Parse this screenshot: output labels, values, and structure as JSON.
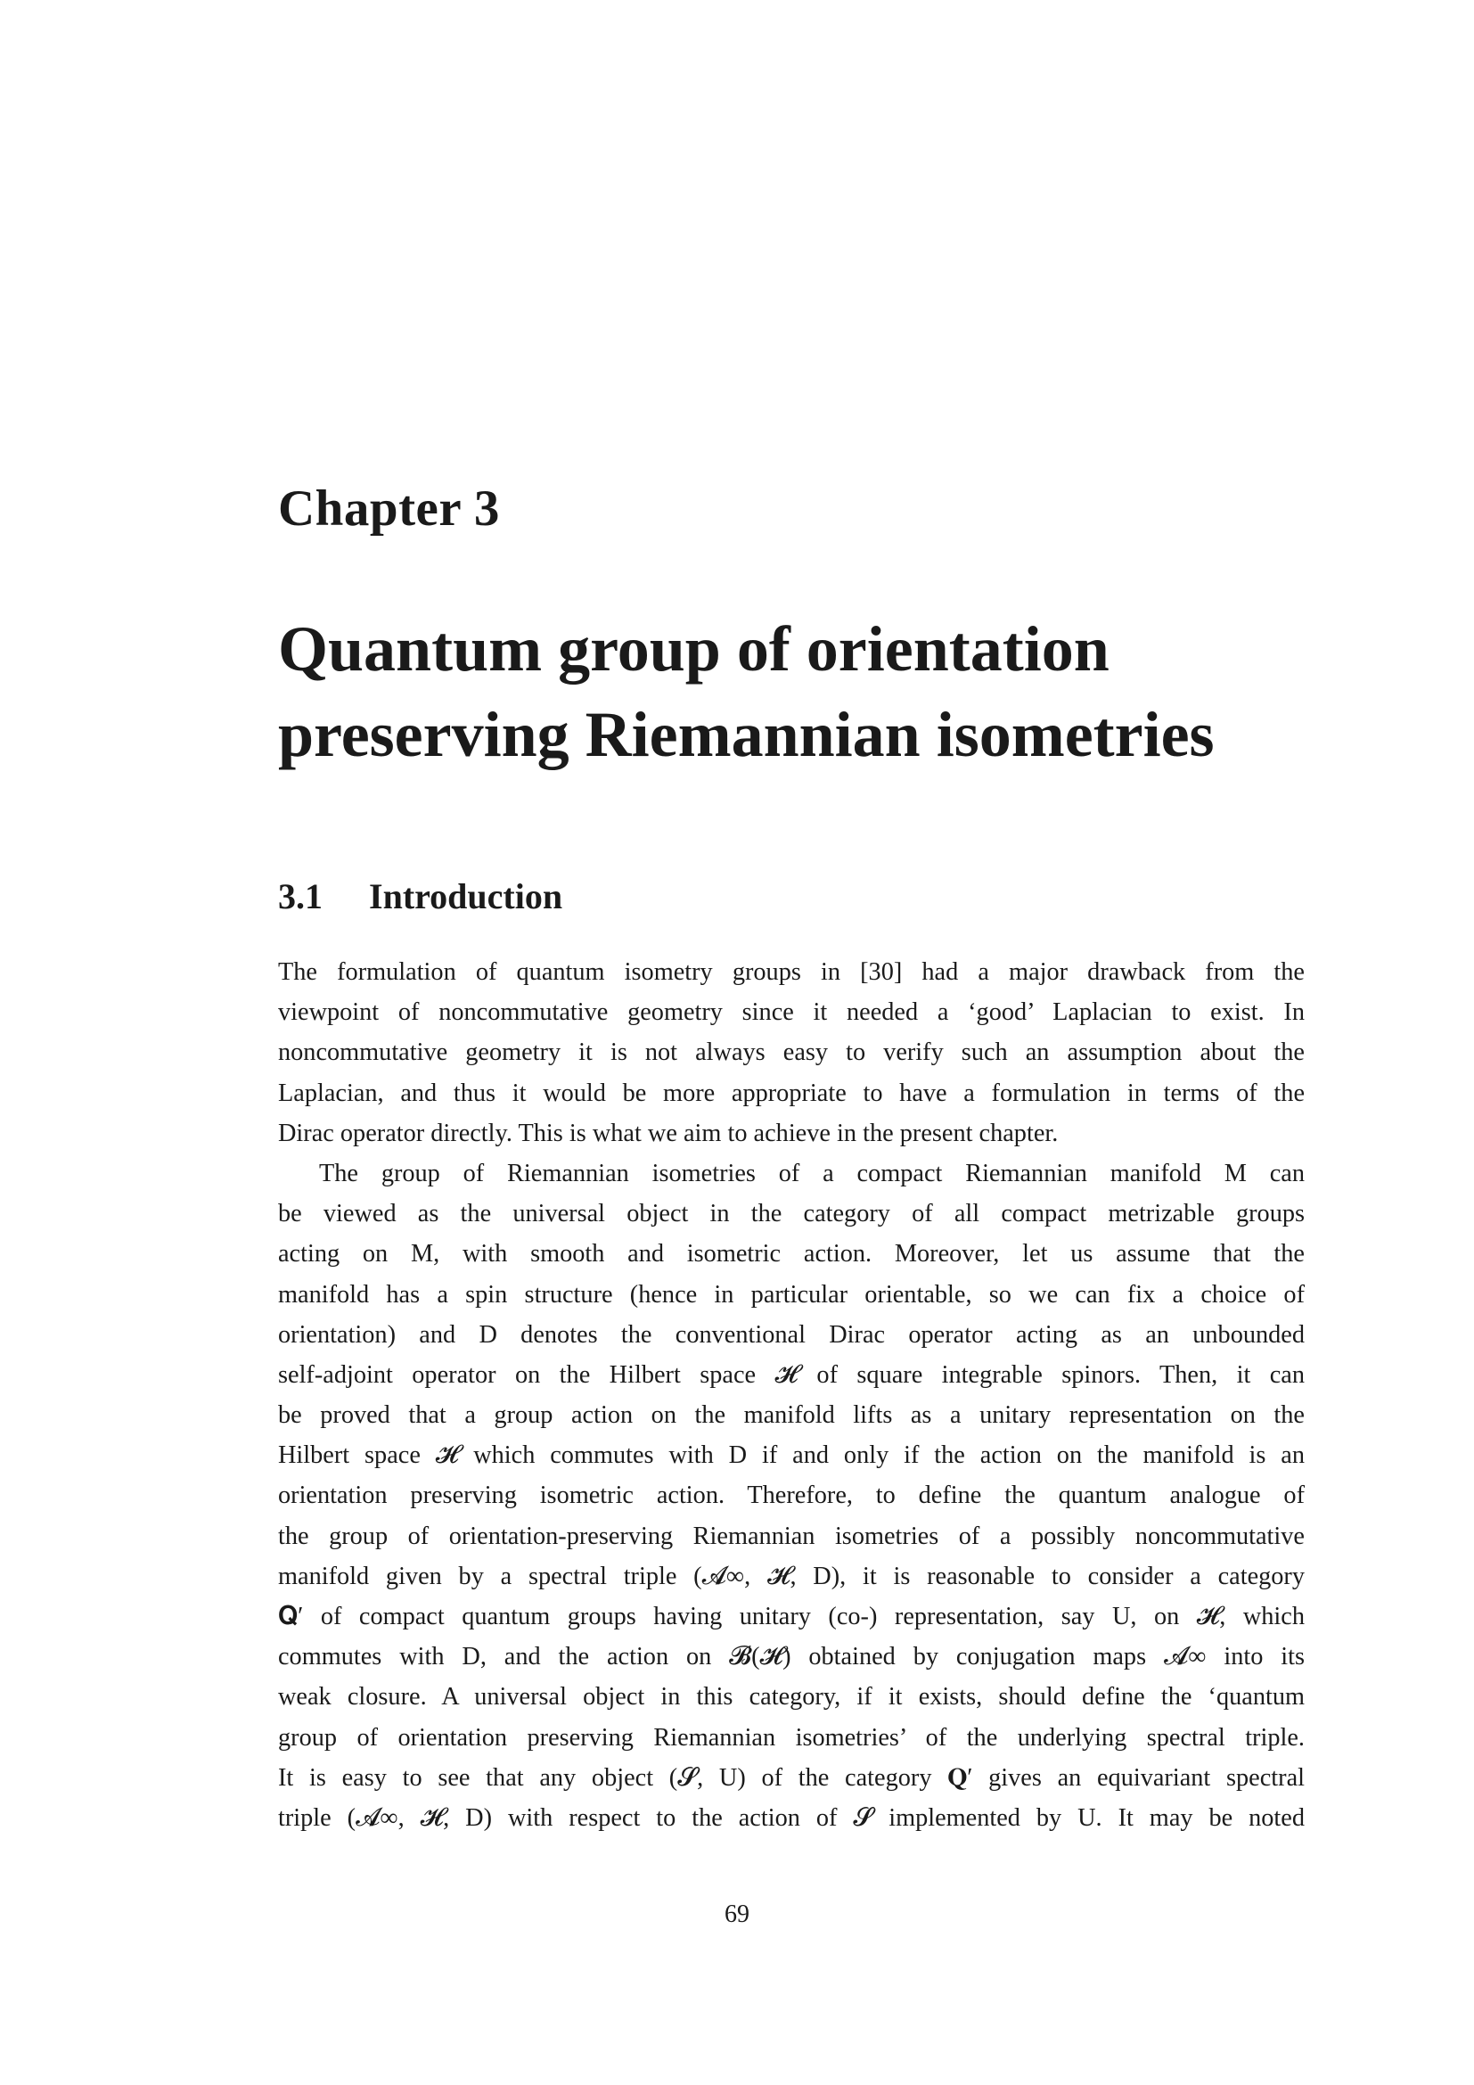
{
  "chapter": {
    "label": "Chapter 3",
    "title_lines": [
      "Quantum group of orientation",
      "preserving Riemannian isometries"
    ]
  },
  "section": {
    "number": "3.1",
    "title": "Introduction"
  },
  "paragraphs": [
    {
      "lines": [
        "The formulation of quantum isometry groups in [30] had a major drawback from the",
        "viewpoint of noncommutative geometry since it needed a ‘good’ Laplacian to exist. In",
        "noncommutative geometry it is not always easy to verify such an assumption about the",
        "Laplacian, and thus it would be more appropriate to have a formulation in terms of the",
        "Dirac operator directly. This is what we aim to achieve in the present chapter."
      ]
    },
    {
      "lines": [
        "The group of Riemannian isometries of a compact Riemannian manifold M can",
        "be viewed as the universal object in the category of all compact metrizable groups",
        "acting on M, with smooth and isometric action. Moreover, let us assume that the",
        "manifold has a spin structure (hence in particular orientable, so we can fix a choice of",
        "orientation) and D denotes the conventional Dirac operator acting as an unbounded",
        "self-adjoint operator on the Hilbert space 𝓗 of square integrable spinors. Then, it can",
        "be proved that a group action on the manifold lifts as a unitary representation on the",
        "Hilbert space 𝓗 which commutes with D if and only if the action on the manifold is an",
        "orientation preserving isometric action. Therefore, to define the quantum analogue of",
        "the group of orientation-preserving Riemannian isometries of a possibly noncommutative",
        "manifold given by a spectral triple (𝓐∞, 𝓗, D), it is reasonable to consider a category",
        "𝐐′ of compact quantum groups having unitary (co-) representation, say U, on 𝓗, which",
        "commutes with D, and the action on 𝓑(𝓗) obtained by conjugation maps 𝓐∞ into its",
        "weak closure. A universal object in this category, if it exists, should define the ‘quantum",
        "group of orientation preserving Riemannian isometries’ of the underlying spectral triple.",
        "It is easy to see that any object (𝓢, U) of the category 𝐐′ gives an equivariant spectral",
        "triple (𝓐∞, 𝓗, D) with respect to the action of 𝓢 implemented by U. It may be noted"
      ]
    }
  ],
  "page_number": "69"
}
